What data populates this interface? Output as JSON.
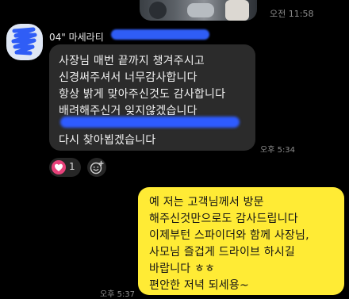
{
  "header": {
    "time": "오전 11:58"
  },
  "incoming": {
    "sender": "04\" 마세라티",
    "lines": [
      "사장님 매번 끝까지 챙겨주시고",
      "신경써주셔서 너무감사합니다",
      "항상 밝게 맞아주신것도 감사합니다",
      "배려해주신거 잊지않겠습니다",
      "",
      "다시 찾아뵙겠습니다"
    ],
    "time": "오후 5:34",
    "reaction": {
      "icon": "heart-icon",
      "count": "1",
      "color": "#e8417a"
    }
  },
  "outgoing": {
    "lines": [
      "예 저는 고객님께서 방문",
      "해주신것만으로도 감사드립니다",
      "이제부턴 스파이더와 함께 사장님,",
      "사모님 즐겁게 드라이브 하시길",
      "바랍니다 ㅎㅎ",
      "편안한 저녁 되세용~"
    ],
    "time": "오후 5:37",
    "bubble_color": "#ffeb35"
  },
  "colors": {
    "background": "#000000",
    "incoming_bubble": "#2b2b2b",
    "redaction": "#2e5bff"
  }
}
